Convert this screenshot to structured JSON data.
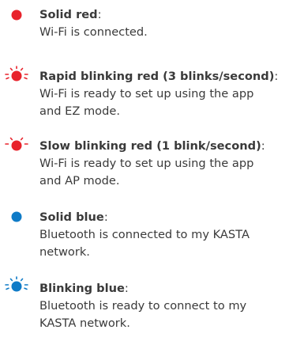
{
  "colors": {
    "red": "#e8232c",
    "blue": "#0f7bc7",
    "text": "#3a3a3a"
  },
  "items": [
    {
      "icon": "solid-red-dot-icon",
      "title": "Solid red",
      "colon": ":",
      "description": "Wi-Fi is connected."
    },
    {
      "icon": "blinking-red-dot-icon",
      "title": "Rapid blinking red (3 blinks/second)",
      "colon": ":",
      "description": "Wi-Fi is ready to set up using the app\nand EZ mode."
    },
    {
      "icon": "blinking-red-dot-icon",
      "title": "Slow blinking red (1 blink/second)",
      "colon": ":",
      "description": "Wi-Fi is ready to set up using the app\nand AP mode."
    },
    {
      "icon": "solid-blue-dot-icon",
      "title": "Solid blue",
      "colon": ":",
      "description": "Bluetooth is connected to my KASTA\nnetwork."
    },
    {
      "icon": "blinking-blue-dot-icon",
      "title": "Blinking blue",
      "colon": ":",
      "description": "Bluetooth is ready to connect to my\nKASTA network."
    }
  ]
}
